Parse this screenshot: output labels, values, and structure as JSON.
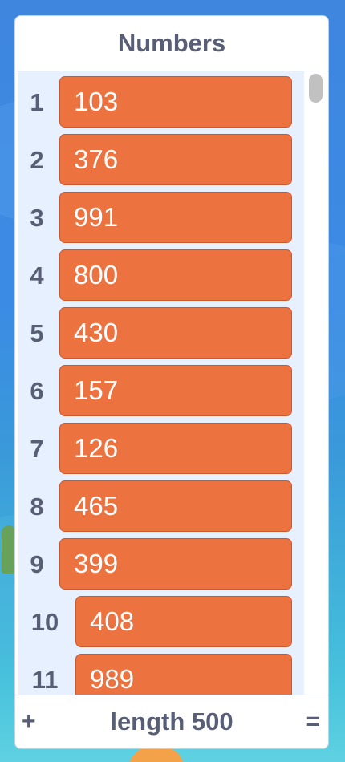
{
  "monitor": {
    "title": "Numbers",
    "items": [
      {
        "index": "1",
        "value": "103"
      },
      {
        "index": "2",
        "value": "376"
      },
      {
        "index": "3",
        "value": "991"
      },
      {
        "index": "4",
        "value": "800"
      },
      {
        "index": "5",
        "value": "430"
      },
      {
        "index": "6",
        "value": "157"
      },
      {
        "index": "7",
        "value": "126"
      },
      {
        "index": "8",
        "value": "465"
      },
      {
        "index": "9",
        "value": "399"
      },
      {
        "index": "10",
        "value": "408"
      },
      {
        "index": "11",
        "value": "989"
      }
    ],
    "footer": {
      "add_label": "+",
      "length_label": "length 500",
      "resize_label": "="
    }
  },
  "colors": {
    "item_fill": "#ec7240",
    "item_border": "#c95a2c",
    "list_background": "#e6f0fe",
    "text_primary": "#575e75"
  },
  "icons": {
    "add": "plus-icon",
    "resize": "equals-resize-icon"
  }
}
